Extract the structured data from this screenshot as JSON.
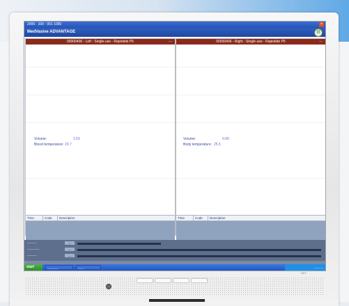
{
  "window": {
    "title_text": "2006 · 100 · 001 1000",
    "close_glyph": "×"
  },
  "app": {
    "title": "MedVasive ADVANTAGE",
    "logo_glyph": "⚙"
  },
  "panes": {
    "left": {
      "header": "00000406 - Left - Single-use - Rapiotide P5",
      "close_glyph": "—",
      "volume_label": "Volume:",
      "volume_value": "1.03",
      "temp_label": "Blood temperature:",
      "temp_value": "23.7",
      "table_headers": [
        "Time",
        "Code",
        "Description"
      ]
    },
    "right": {
      "header": "00000406 - Right - Single-use - Rapiotide P5",
      "close_glyph": "—",
      "volume_label": "Volume:",
      "volume_value": "0.00",
      "temp_label": "Body temperature:",
      "temp_value": "25.5",
      "table_headers": [
        "Time",
        "Code",
        "Description"
      ]
    }
  },
  "status": {
    "rows": [
      {
        "label": "———",
        "chip": "—"
      },
      {
        "label": "————",
        "chip": "—"
      },
      {
        "label": "———",
        "chip": "—"
      }
    ],
    "info_text": "..."
  },
  "taskbar": {
    "start_label": "start",
    "tasks": [
      "————",
      "——"
    ],
    "tray_text": "—— —"
  },
  "brand": "NEC",
  "colors": {
    "header_red": "#8b2a1c",
    "xp_blue": "#2553b8",
    "table_blue": "#8fa3bf",
    "status_gray": "#5d6f8c"
  }
}
